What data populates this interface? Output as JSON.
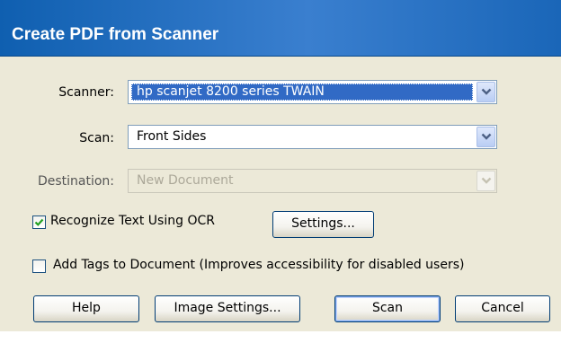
{
  "window": {
    "title": "Create PDF from Scanner"
  },
  "form": {
    "scanner": {
      "label": "Scanner:",
      "value": "hp scanjet 8200 series TWAIN"
    },
    "scan": {
      "label": "Scan:",
      "value": "Front Sides"
    },
    "destination": {
      "label": "Destination:",
      "value": "New Document",
      "enabled": false
    },
    "ocr": {
      "label": "Recognize Text Using OCR",
      "checked": true,
      "settings_button": "Settings..."
    },
    "tags": {
      "label": "Add Tags to Document (Improves accessibility for disabled users)",
      "checked": false
    }
  },
  "buttons": {
    "help": "Help",
    "image_settings": "Image Settings...",
    "scan": "Scan",
    "cancel": "Cancel"
  },
  "colors": {
    "title_bar": "#1a66b8",
    "dialog_bg": "#ece9d8",
    "selection": "#316ac5"
  },
  "icons": {
    "dropdown": "chevron-down-icon",
    "check": "checkmark-icon"
  }
}
